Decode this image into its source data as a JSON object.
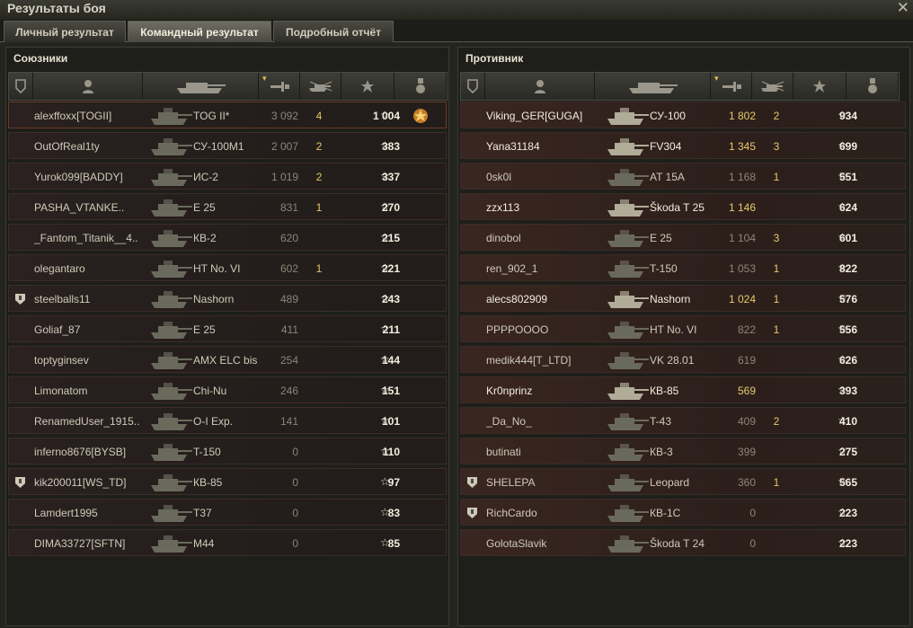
{
  "window": {
    "title": "Результаты боя",
    "close_glyph": "✕"
  },
  "tabs": [
    {
      "label": "Личный результат",
      "active": false
    },
    {
      "label": "Командный результат",
      "active": true
    },
    {
      "label": "Подробный отчёт",
      "active": false
    }
  ],
  "columns": [
    "badge-icon",
    "player-icon",
    "tank-icon",
    "damage-icon",
    "frags-icon",
    "xp-star-icon",
    "medal-icon"
  ],
  "allies": {
    "title": "Союзники",
    "rows": [
      {
        "name": "alexffoxx[TOGII]",
        "tank": "TOG II*",
        "damage": "3 092",
        "frags": "4",
        "xp": "1 004",
        "player": true,
        "alive": false,
        "badge": false,
        "medal": true
      },
      {
        "name": "OutOfReal1ty",
        "tank": "СУ-100М1",
        "damage": "2 007",
        "frags": "2",
        "xp": "383",
        "alive": false
      },
      {
        "name": "Yurok099[BADDY]",
        "tank": "ИС-2",
        "damage": "1 019",
        "frags": "2",
        "xp": "337",
        "alive": false
      },
      {
        "name": "PASHA_VTANKE..",
        "tank": "E 25",
        "damage": "831",
        "frags": "1",
        "xp": "270",
        "alive": false
      },
      {
        "name": "_Fantom_Titanik__4..",
        "tank": "КВ-2",
        "damage": "620",
        "frags": "",
        "xp": "215",
        "alive": false
      },
      {
        "name": "olegantaro",
        "tank": "HT No. VI",
        "damage": "602",
        "frags": "1",
        "xp": "221",
        "alive": false
      },
      {
        "name": "steelballs11",
        "tank": "Nashorn",
        "damage": "489",
        "frags": "",
        "xp": "243",
        "alive": false,
        "badge": true
      },
      {
        "name": "Goliaf_87",
        "tank": "E 25",
        "damage": "411",
        "frags": "",
        "xp": "211",
        "alive": false
      },
      {
        "name": "toptyginsev",
        "tank": "AMX ELC bis",
        "damage": "254",
        "frags": "",
        "xp": "144",
        "alive": false
      },
      {
        "name": "Limonatom",
        "tank": "Chi-Nu",
        "damage": "246",
        "frags": "",
        "xp": "151",
        "alive": false
      },
      {
        "name": "RenamedUser_1915..",
        "tank": "O-I Exp.",
        "damage": "141",
        "frags": "",
        "xp": "101",
        "alive": false
      },
      {
        "name": "inferno8676[BYSB]",
        "tank": "T-150",
        "damage": "0",
        "frags": "",
        "xp": "110",
        "alive": false
      },
      {
        "name": "kik200011[WS_TD]",
        "tank": "КВ-85",
        "damage": "0",
        "frags": "",
        "xp": "97",
        "alive": false,
        "badge": true
      },
      {
        "name": "Lamdert1995",
        "tank": "T37",
        "damage": "0",
        "frags": "",
        "xp": "83",
        "alive": false
      },
      {
        "name": "DIMA33727[SFTN]",
        "tank": "M44",
        "damage": "0",
        "frags": "",
        "xp": "85",
        "alive": false
      }
    ]
  },
  "enemies": {
    "title": "Противник",
    "rows": [
      {
        "name": "Viking_GER[GUGA]",
        "tank": "СУ-100",
        "damage": "1 802",
        "frags": "2",
        "xp": "934",
        "alive": true,
        "dmg_hi": true
      },
      {
        "name": "Yana31184",
        "tank": "FV304",
        "damage": "1 345",
        "frags": "3",
        "xp": "699",
        "alive": true,
        "dmg_hi": true
      },
      {
        "name": "0sk0l",
        "tank": "AT 15A",
        "damage": "1 168",
        "frags": "1",
        "xp": "551",
        "alive": false
      },
      {
        "name": "zzx113",
        "tank": "Škoda T 25",
        "damage": "1 146",
        "frags": "",
        "xp": "624",
        "alive": true,
        "dmg_hi": true
      },
      {
        "name": "dinobol",
        "tank": "E 25",
        "damage": "1 104",
        "frags": "3",
        "xp": "601",
        "alive": false
      },
      {
        "name": "ren_902_1",
        "tank": "T-150",
        "damage": "1 053",
        "frags": "1",
        "xp": "822",
        "alive": false
      },
      {
        "name": "alecs802909",
        "tank": "Nashorn",
        "damage": "1 024",
        "frags": "1",
        "xp": "576",
        "alive": true,
        "dmg_hi": true
      },
      {
        "name": "PPPPOOOO",
        "tank": "HT No. VI",
        "damage": "822",
        "frags": "1",
        "xp": "556",
        "alive": false
      },
      {
        "name": "medik444[T_LTD]",
        "tank": "VK 28.01",
        "damage": "619",
        "frags": "",
        "xp": "626",
        "alive": false
      },
      {
        "name": "Kr0nprinz",
        "tank": "КВ-85",
        "damage": "569",
        "frags": "",
        "xp": "393",
        "alive": true,
        "dmg_hi": true
      },
      {
        "name": "_Da_No_",
        "tank": "T-43",
        "damage": "409",
        "frags": "2",
        "xp": "410",
        "alive": false
      },
      {
        "name": "butinati",
        "tank": "КВ-3",
        "damage": "399",
        "frags": "",
        "xp": "275",
        "alive": false
      },
      {
        "name": "SHELEPA",
        "tank": "Leopard",
        "damage": "360",
        "frags": "1",
        "xp": "565",
        "alive": false,
        "badge": true
      },
      {
        "name": "RichCardo",
        "tank": "КВ-1С",
        "damage": "0",
        "frags": "",
        "xp": "223",
        "alive": false,
        "badge": true
      },
      {
        "name": "GolotaSlavik",
        "tank": "Škoda T 24",
        "damage": "0",
        "frags": "",
        "xp": "223",
        "alive": false
      }
    ]
  },
  "colors": {
    "accent": "#e8c86a",
    "player_row": "#7a3418"
  },
  "star_glyph": "☆"
}
